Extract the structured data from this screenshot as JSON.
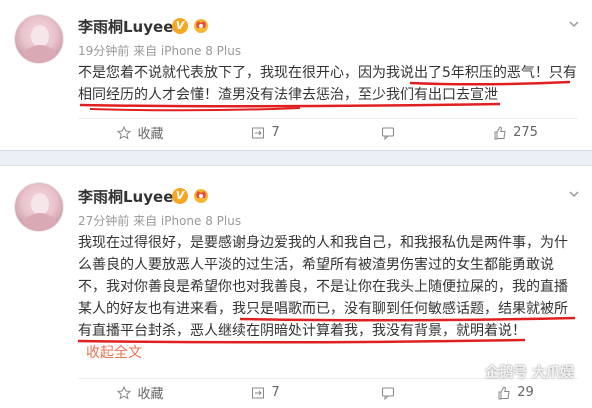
{
  "posts": [
    {
      "author": "李雨桐Luyee",
      "verified_badge": "V",
      "meta": "19分钟前 来自 iPhone 8 Plus",
      "lines": [
        "不是您着不说就代表放下了，我现在很开心，因为我说出了5年积压的恶气！只有",
        "相同经历的人才会懂！渣男没有法律去惩治，至少我们有出口去宣泄"
      ],
      "actions": {
        "favorite": "收藏",
        "repost": "7",
        "comment": "",
        "like": "275"
      }
    },
    {
      "author": "李雨桐Luyee",
      "verified_badge": "V",
      "meta": "27分钟前 来自 iPhone 8 Plus",
      "lines": [
        "我现在过得很好，是要感谢身边爱我的人和我自己，和我报私仇是两件事，为什",
        "么善良的人要放恶人平淡的过生活，希望所有被渣男伤害过的女生都能勇敢说",
        "不，我对你善良是希望你也对我善良，不是让你在我头上随便拉屎的，我的直播",
        "某人的好友也有进来看，我只是唱歌而已，没有聊到任何敏感话题，结果就被所",
        "有直播平台封杀，恶人继续在阴暗处计算着我，我没有背景，就明着说！"
      ],
      "collapse": "收起全文",
      "actions": {
        "favorite": "收藏",
        "repost": "7",
        "comment": "",
        "like": "29"
      }
    }
  ],
  "watermark": "企鹅号 大爪娱",
  "colors": {
    "accent_orange": "#eb7350",
    "underline_red": "#e02020",
    "badge_gold": "#f5a623"
  },
  "icons": [
    "chevron-down-icon",
    "star-icon",
    "repost-icon",
    "comment-icon",
    "thumb-up-icon",
    "crown-icon"
  ]
}
